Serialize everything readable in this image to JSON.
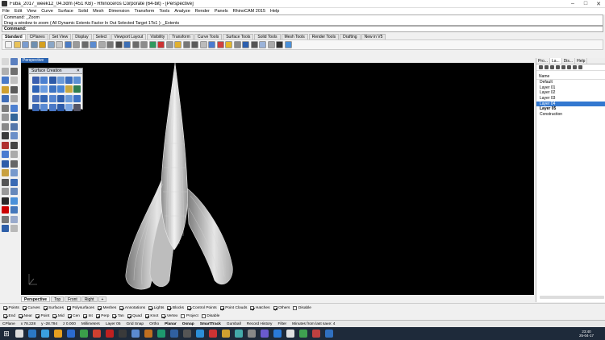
{
  "window": {
    "title": "Fuba_2017_week12_04.3dm (451 KB) - Rhinoceros Corporate (64-bit) - [Perspective]",
    "minimize": "–",
    "maximize": "□",
    "close": "✕"
  },
  "menu": [
    "File",
    "Edit",
    "View",
    "Curve",
    "Surface",
    "Solid",
    "Mesh",
    "Dimension",
    "Transform",
    "Tools",
    "Analyze",
    "Render",
    "Panels",
    "RhinoCAM 2015",
    "Help"
  ],
  "command_history": {
    "line1": "Command: _Zoom",
    "line2": "Drag a window to zoom ( All  Dynamic  Extents  Factor  In  Out  Selected  Target  1To1 ): _Extents"
  },
  "command_prompt": {
    "label": "Command:",
    "value": ""
  },
  "toolbar_tabs": [
    "Standard",
    "CPlanes",
    "Set View",
    "Display",
    "Select",
    "Viewport Layout",
    "Visibility",
    "Transform",
    "Curve Tools",
    "Surface Tools",
    "Solid Tools",
    "Mesh Tools",
    "Render Tools",
    "Drafting",
    "New in V5"
  ],
  "toolbar_tab_active": "Standard",
  "toolbar_icon_colors": [
    "#f2f2f2",
    "#e8c25a",
    "#7a9ccf",
    "#6f8fb0",
    "#d5a020",
    "#8aa6c6",
    "#c8c8c8",
    "#4c7cc4",
    "#9a9a9a",
    "#6a6a6a",
    "#5b8bd0",
    "#aaa",
    "#777",
    "#4a4a4a",
    "#3d6fb5",
    "#6b6b6b",
    "#8c8c8c",
    "#2f9a5e",
    "#c33",
    "#999",
    "#e0b030",
    "#777",
    "#5b5b5b",
    "#bbb",
    "#4a7bd1",
    "#d04040",
    "#e4b72a",
    "#888",
    "#2d5fae",
    "#555",
    "#9bb3d9",
    "#aaa",
    "#333",
    "#4a90d9"
  ],
  "viewport": {
    "label": "Perspective"
  },
  "surface_creation": {
    "title": "Surface Creation",
    "close": "✕",
    "icon_colors": [
      "#3a5fb0",
      "#4a80d0",
      "#2d5ba8",
      "#6a9ad8",
      "#3b6fc0",
      "#5a8fd4",
      "#2f63b6",
      "#6b9de0",
      "#3c73c2",
      "#4784d4",
      "#c8a840",
      "#2e7d4e",
      "#4a6fb8",
      "#3466b4",
      "#5384d0",
      "#2e5fae",
      "#6a9ad8",
      "#3d72c4",
      "#3a66b2",
      "#5a8ad2",
      "#4a78c6",
      "#2c5aa8",
      "#7aa5e2",
      "#556"
    ]
  },
  "left_tool_colors": [
    "#d8d8d8",
    "#5a7fbf",
    "#b0b0b0",
    "#6f6f6f",
    "#4a7ac8",
    "#c0c0c0",
    "#d0a030",
    "#5a5a5a",
    "#3f6db8",
    "#a8a8a8",
    "#7b7b7b",
    "#4d80d0",
    "#999",
    "#336699",
    "#888",
    "#5577aa",
    "#3b3b3b",
    "#6b8fc8",
    "#b03030",
    "#444",
    "#4a7bd0",
    "#aaa",
    "#2e5ca8",
    "#666",
    "#c8a040",
    "#7799cc",
    "#555",
    "#3a6ab4",
    "#999",
    "#6688bb",
    "#2a2a2a",
    "#4a90d9",
    "#c00",
    "#4477bb",
    "#777",
    "#99aacc",
    "#2f5fa8",
    "#b8b8b8"
  ],
  "viewport_tabs": [
    "Perspective",
    "Top",
    "Front",
    "Right",
    "+"
  ],
  "viewport_tab_active": "Perspective",
  "right_panel": {
    "tabs": [
      "Pro...",
      "La...",
      "Dis...",
      "Help"
    ],
    "active_tab": "La...",
    "column_header": "Name",
    "layers": [
      {
        "name": "Default",
        "selected": false,
        "bold": false
      },
      {
        "name": "Layer 01",
        "selected": false,
        "bold": false
      },
      {
        "name": "Layer 02",
        "selected": false,
        "bold": false
      },
      {
        "name": "Layer 03",
        "selected": false,
        "bold": false
      },
      {
        "name": "Layer 04",
        "selected": true,
        "bold": false
      },
      {
        "name": "Layer 05",
        "selected": false,
        "bold": true
      },
      {
        "name": "Construction",
        "selected": false,
        "bold": false
      }
    ]
  },
  "osnap_row1": [
    {
      "label": "Points",
      "on": true
    },
    {
      "label": "Curves",
      "on": true
    },
    {
      "label": "Surfaces",
      "on": true
    },
    {
      "label": "Polysurfaces",
      "on": true
    },
    {
      "label": "Meshes",
      "on": true
    },
    {
      "label": "Annotations",
      "on": true
    },
    {
      "label": "Lights",
      "on": true
    },
    {
      "label": "Blocks",
      "on": true
    },
    {
      "label": "Control Points",
      "on": true
    },
    {
      "label": "Point Clouds",
      "on": true
    },
    {
      "label": "Hatches",
      "on": true
    },
    {
      "label": "Others",
      "on": true
    },
    {
      "label": "Disable",
      "on": false
    }
  ],
  "osnap_row2": [
    {
      "label": "End",
      "on": true
    },
    {
      "label": "Near",
      "on": true
    },
    {
      "label": "Point",
      "on": true
    },
    {
      "label": "Mid",
      "on": true
    },
    {
      "label": "Cen",
      "on": true
    },
    {
      "label": "Int",
      "on": true
    },
    {
      "label": "Perp",
      "on": true
    },
    {
      "label": "Tan",
      "on": true
    },
    {
      "label": "Quad",
      "on": true
    },
    {
      "label": "Knot",
      "on": true
    },
    {
      "label": "Vertex",
      "on": true
    },
    {
      "label": "Project",
      "on": false
    },
    {
      "label": "Disable",
      "on": false
    }
  ],
  "status": {
    "cplane": "CPlane",
    "x": "x 78.228",
    "y": "y -28.794",
    "z": "z 0.000",
    "units": "Millimeters",
    "layer": "Layer 05",
    "grid_snap": "Grid Snap",
    "ortho": "Ortho",
    "planar": "Planar",
    "osnap": "Osnap",
    "smarttrack": "SmartTrack",
    "gumball": "Gumball",
    "record_history": "Record History",
    "filter": "Filter",
    "last_save": "Minutes from last save: 4"
  },
  "taskbar": {
    "start": "⊞",
    "icon_colors": [
      "#ddd",
      "#2b78c4",
      "#3aa0e0",
      "#e6a020",
      "#2b6bd0",
      "#3b9e4a",
      "#d04030",
      "#c02020",
      "#3a3a3a",
      "#5b8bd0",
      "#c07020",
      "#1e9a6e",
      "#3060a0",
      "#555",
      "#2c8fd8",
      "#c33",
      "#d0a030",
      "#4aa",
      "#888",
      "#6a5acd",
      "#2a7ad8",
      "#e0e0e0",
      "#3fa050",
      "#c04040",
      "#3070c0"
    ],
    "tray": "^ ♪ ▭ FRA",
    "time": "23:40",
    "date": "25-04-17"
  }
}
